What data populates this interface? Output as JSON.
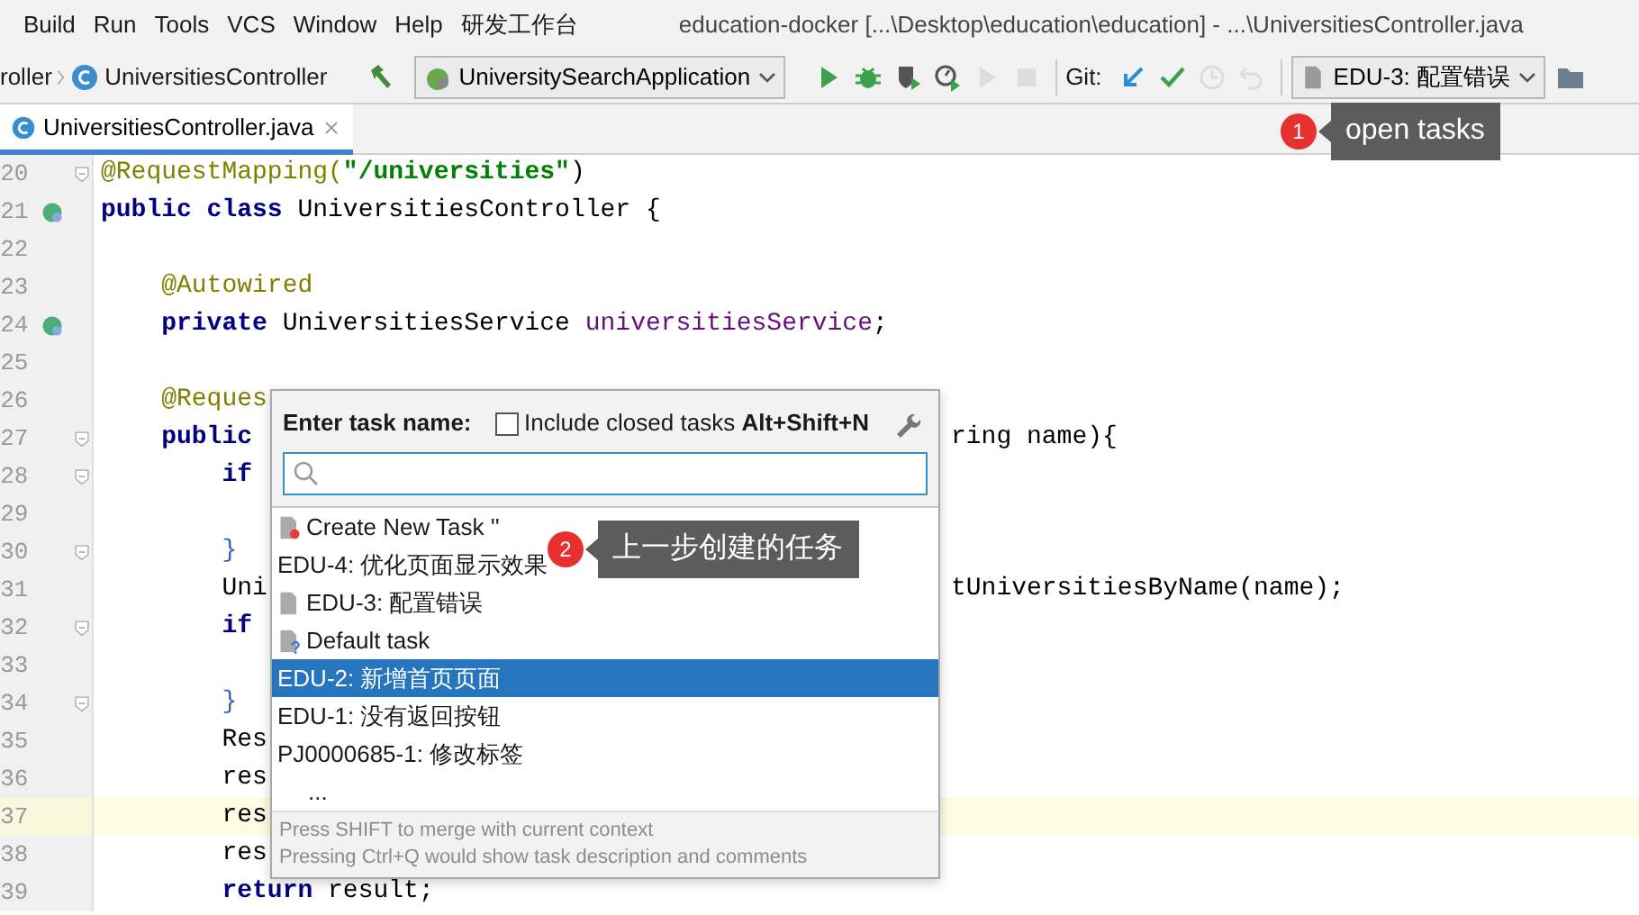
{
  "window": {
    "title": "education-docker [...\\Desktop\\education\\education] - ...\\UniversitiesController.java"
  },
  "menu": [
    "Build",
    "Run",
    "Tools",
    "VCS",
    "Window",
    "Help",
    "研发工作台"
  ],
  "toolbar": {
    "breadcrumbs": [
      "roller",
      "UniversitiesController"
    ],
    "run_config": "UniversitySearchApplication",
    "git_label": "Git:",
    "task": "EDU-3: 配置错误",
    "buttons": [
      {
        "kind": "run",
        "disabled": false
      },
      {
        "kind": "debug",
        "disabled": false
      },
      {
        "kind": "coverage",
        "disabled": false
      },
      {
        "kind": "profile",
        "disabled": false
      },
      {
        "kind": "attach",
        "disabled": true
      },
      {
        "kind": "stop",
        "disabled": true
      }
    ],
    "git_buttons": [
      {
        "kind": "update",
        "disabled": false
      },
      {
        "kind": "commit",
        "disabled": false
      },
      {
        "kind": "history",
        "disabled": true
      },
      {
        "kind": "revert",
        "disabled": true
      }
    ]
  },
  "tabs": [
    {
      "label": "UniversitiesController.java",
      "selected": true
    }
  ],
  "editor": {
    "lines": [
      {
        "number": "20",
        "folding": true,
        "current": false,
        "segments": [
          {
            "kind": "annotation",
            "text": "@RequestMapping("
          },
          {
            "kind": "string",
            "text": "\"/universities\""
          },
          {
            "kind": "plain",
            "text": ")"
          }
        ]
      },
      {
        "number": "21",
        "bean": true,
        "current": false,
        "segments": [
          {
            "kind": "keyword",
            "text": "public class "
          },
          {
            "kind": "plain",
            "text": "UniversitiesController {"
          }
        ]
      },
      {
        "number": "22",
        "current": false
      },
      {
        "number": "23",
        "current": false,
        "segments": [
          {
            "kind": "annotation",
            "text": "    @Autowired"
          }
        ]
      },
      {
        "number": "24",
        "bean": true,
        "current": false,
        "segments": [
          {
            "kind": "keyword",
            "text": "    private "
          },
          {
            "kind": "plain",
            "text": "UniversitiesService "
          },
          {
            "kind": "field",
            "text": "universitiesService"
          },
          {
            "kind": "plain",
            "text": ";"
          }
        ]
      },
      {
        "number": "25",
        "current": false
      },
      {
        "number": "26",
        "current": false,
        "segments": [
          {
            "kind": "annotation",
            "text": "    @Reques"
          }
        ]
      },
      {
        "number": "27",
        "folding": true,
        "current": false,
        "segments": [
          {
            "kind": "keyword",
            "text": "    public"
          }
        ],
        "right": "ring name){"
      },
      {
        "number": "28",
        "folding": true,
        "current": false,
        "segments": [
          {
            "kind": "keyword",
            "text": "        if"
          }
        ]
      },
      {
        "number": "29",
        "current": false
      },
      {
        "number": "30",
        "folding": true,
        "current": false,
        "segments": [
          {
            "kind": "brace",
            "text": "        }"
          }
        ]
      },
      {
        "number": "31",
        "current": false,
        "segments": [
          {
            "kind": "plain",
            "text": "        Uni"
          }
        ],
        "right": "tUniversitiesByName(name);"
      },
      {
        "number": "32",
        "folding": true,
        "current": false,
        "segments": [
          {
            "kind": "keyword",
            "text": "        if"
          }
        ]
      },
      {
        "number": "33",
        "current": false
      },
      {
        "number": "34",
        "folding": true,
        "current": false,
        "segments": [
          {
            "kind": "brace",
            "text": "        }"
          }
        ]
      },
      {
        "number": "35",
        "current": false,
        "segments": [
          {
            "kind": "plain",
            "text": "        Res"
          }
        ]
      },
      {
        "number": "36",
        "current": false,
        "segments": [
          {
            "kind": "plain",
            "text": "        res"
          }
        ]
      },
      {
        "number": "37",
        "current": true,
        "segments": [
          {
            "kind": "plain",
            "text": "        res"
          }
        ]
      },
      {
        "number": "38",
        "current": false,
        "segments": [
          {
            "kind": "plain",
            "text": "        res"
          }
        ]
      },
      {
        "number": "39",
        "current": false,
        "segments": [
          {
            "kind": "keyword",
            "text": "        return "
          },
          {
            "kind": "plain",
            "text": "result;"
          }
        ]
      }
    ]
  },
  "task_popup": {
    "prompt": "Enter task name:",
    "include_closed": {
      "label": "Include closed tasks",
      "shortcut": "Alt+Shift+N",
      "checked": false
    },
    "items": [
      {
        "kind": "new-task",
        "label": "Create New Task ''",
        "selected": false
      },
      {
        "kind": "plain",
        "label": "EDU-4: 优化页面显示效果",
        "selected": false
      },
      {
        "kind": "file",
        "label": "EDU-3: 配置错误",
        "selected": false
      },
      {
        "kind": "default",
        "label": "Default task",
        "selected": false
      },
      {
        "kind": "plain",
        "label": "EDU-2: 新增首页页面",
        "selected": true
      },
      {
        "kind": "plain",
        "label": "EDU-1: 没有返回按钮",
        "selected": false
      },
      {
        "kind": "plain",
        "label": "PJ0000685-1: 修改标签",
        "selected": false
      },
      {
        "kind": "more",
        "label": "...",
        "selected": false
      }
    ],
    "hints": [
      "Press SHIFT to merge with current context",
      "Pressing Ctrl+Q would show task description and comments"
    ]
  },
  "callouts": [
    {
      "number": "1",
      "text": "open tasks"
    },
    {
      "number": "2",
      "text": "上一步创建的任务"
    }
  ]
}
